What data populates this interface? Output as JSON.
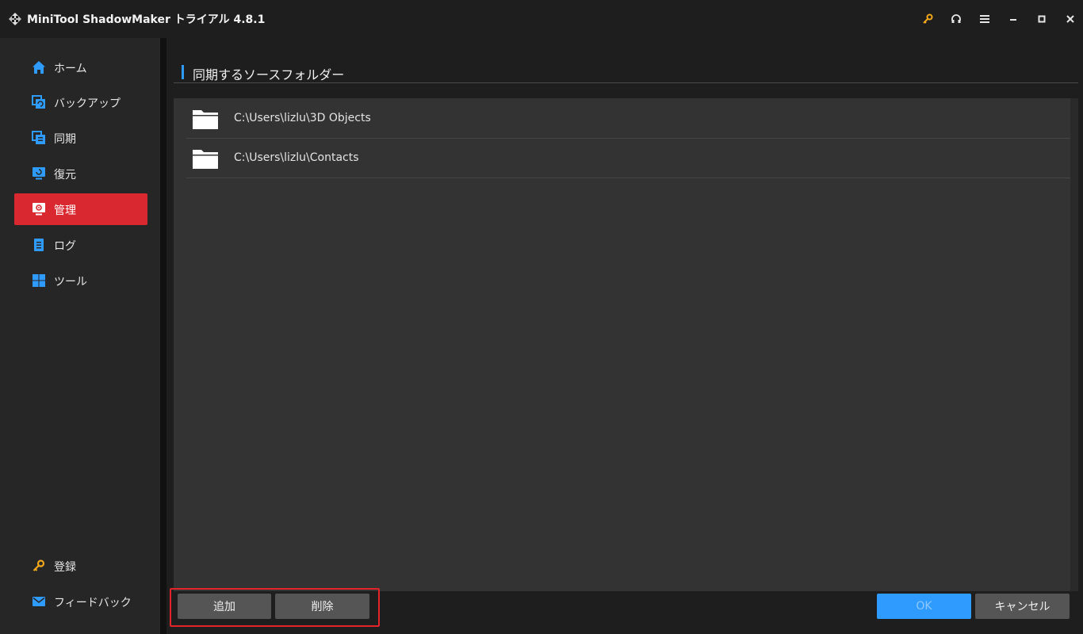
{
  "app": {
    "title": "MiniTool ShadowMaker トライアル 4.8.1"
  },
  "titlebar": {
    "icons": [
      "key-icon",
      "headset-icon",
      "menu-icon",
      "minimize-icon",
      "maximize-icon",
      "close-icon"
    ],
    "key_color": "#f3a71a"
  },
  "sidebar": {
    "items": [
      {
        "label": "ホーム",
        "icon": "home-icon"
      },
      {
        "label": "バックアップ",
        "icon": "backup-icon"
      },
      {
        "label": "同期",
        "icon": "sync-icon"
      },
      {
        "label": "復元",
        "icon": "restore-icon"
      },
      {
        "label": "管理",
        "icon": "manage-icon",
        "active": true
      },
      {
        "label": "ログ",
        "icon": "log-icon"
      },
      {
        "label": "ツール",
        "icon": "tools-icon"
      }
    ],
    "bottom": [
      {
        "label": "登録",
        "icon": "key-icon"
      },
      {
        "label": "フィードバック",
        "icon": "mail-icon"
      }
    ]
  },
  "main": {
    "section_title": "同期するソースフォルダー",
    "folders": [
      {
        "path": "C:\\Users\\lizlu\\3D Objects"
      },
      {
        "path": "C:\\Users\\lizlu\\Contacts"
      }
    ]
  },
  "footer": {
    "add_label": "追加",
    "delete_label": "削除",
    "ok_label": "OK",
    "cancel_label": "キャンセル"
  },
  "colors": {
    "accent_blue": "#2f9bff",
    "active_red": "#d9282f",
    "highlight_red": "#e3242b"
  }
}
